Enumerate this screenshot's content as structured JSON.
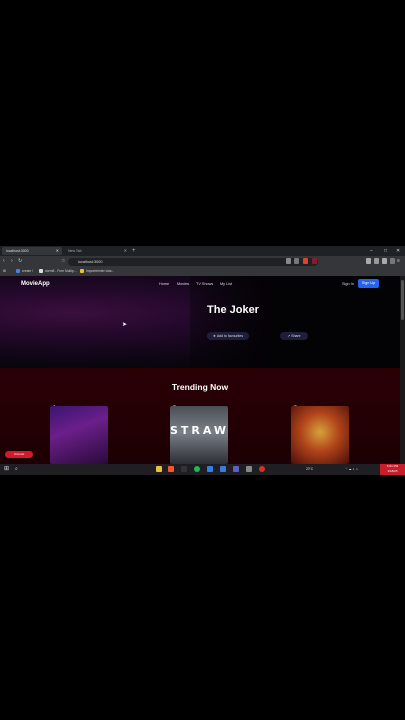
{
  "browser": {
    "tabs": [
      {
        "label": "localhost:3000"
      },
      {
        "label": "New Tab"
      }
    ],
    "address": "localhost:3000",
    "bookmarks": [
      "create !",
      "dorm8 - Free Multip...",
      "Importerinter clas..."
    ]
  },
  "app": {
    "logo": "MovieApp",
    "nav": [
      "Home",
      "Movies",
      "TV Shows",
      "My List"
    ],
    "sign_in": "Sign In",
    "sign_up": "Sign Up"
  },
  "hero": {
    "title": "The Joker",
    "favourite_label": "Add to favourites",
    "share_label": "Share"
  },
  "trending": {
    "title": "Trending Now",
    "items": [
      {
        "rank": "1"
      },
      {
        "rank": "2",
        "poster_text": "STRAW"
      },
      {
        "rank": "3"
      }
    ]
  },
  "overlay": {
    "unmute": "Unmute"
  },
  "taskbar": {
    "weather": "20°C",
    "time": "5:01 PM",
    "date": "3/18/25"
  },
  "colors": {
    "signup_button": "#2563eb",
    "trending_bg": "#2a0005",
    "unmute_badge": "#d11a2a"
  }
}
